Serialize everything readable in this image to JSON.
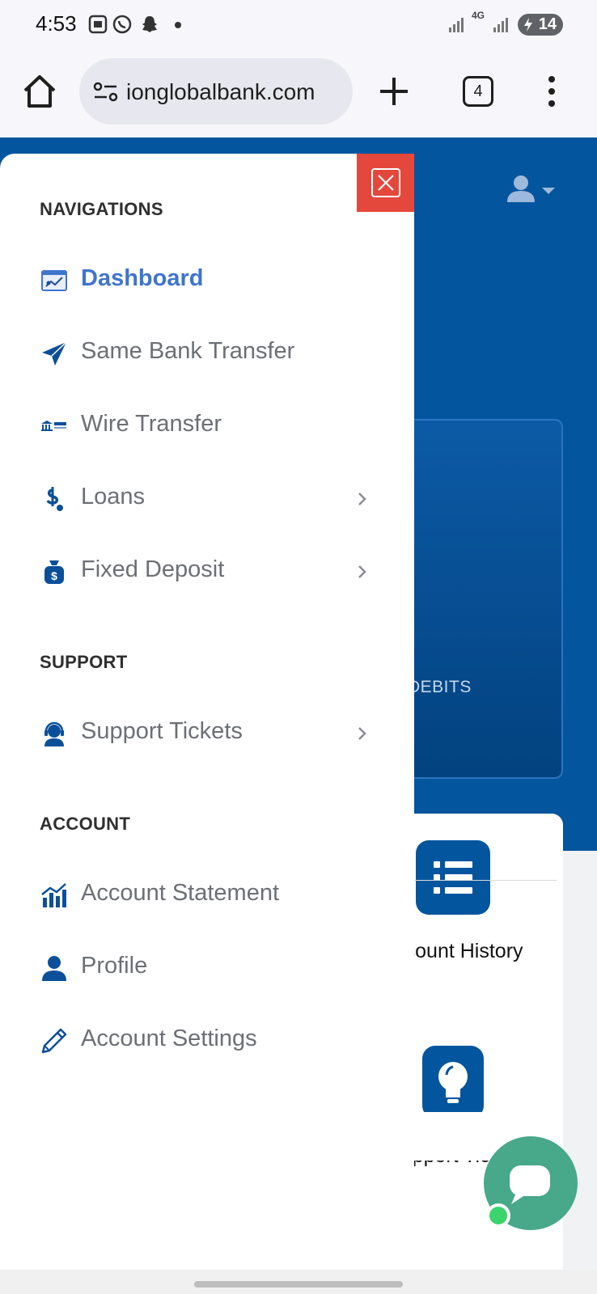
{
  "status_bar": {
    "time": "4:53",
    "network": "4G",
    "battery": "14"
  },
  "browser": {
    "url": "ionglobalbank.com",
    "tab_count": "4"
  },
  "page": {
    "debits_label": "DEBITS",
    "actions": [
      {
        "label": "Account History",
        "icon": "list-icon"
      },
      {
        "label": "Support Ticket",
        "icon": "lightbulb-icon"
      }
    ]
  },
  "drawer": {
    "sections": [
      {
        "title": "NAVIGATIONS",
        "items": [
          {
            "label": "Dashboard",
            "icon": "dashboard-icon",
            "active": true,
            "has_submenu": false
          },
          {
            "label": "Same Bank Transfer",
            "icon": "paper-plane-icon",
            "active": false,
            "has_submenu": false
          },
          {
            "label": "Wire Transfer",
            "icon": "bank-icon",
            "active": false,
            "has_submenu": false
          },
          {
            "label": "Loans",
            "icon": "dollar-hand-icon",
            "active": false,
            "has_submenu": true
          },
          {
            "label": "Fixed Deposit",
            "icon": "money-bag-icon",
            "active": false,
            "has_submenu": true
          }
        ]
      },
      {
        "title": "SUPPORT",
        "items": [
          {
            "label": "Support Tickets",
            "icon": "headset-icon",
            "active": false,
            "has_submenu": true
          }
        ]
      },
      {
        "title": "ACCOUNT",
        "items": [
          {
            "label": "Account Statement",
            "icon": "chart-icon",
            "active": false,
            "has_submenu": false
          },
          {
            "label": "Profile",
            "icon": "user-icon",
            "active": false,
            "has_submenu": false
          },
          {
            "label": "Account Settings",
            "icon": "pencil-icon",
            "active": false,
            "has_submenu": false
          }
        ]
      }
    ]
  },
  "colors": {
    "brand_blue": "#03559e",
    "active_link": "#3f75cc",
    "close_red": "#e4483d",
    "chat_green": "#47a88a"
  }
}
